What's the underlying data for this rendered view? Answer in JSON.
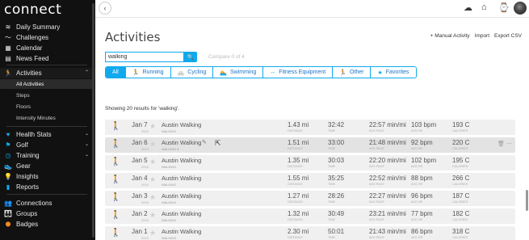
{
  "app": {
    "logo": "connect"
  },
  "sidebar": {
    "items": [
      {
        "label": "Daily Summary",
        "icon": "≋",
        "icon_name": "daily-summary-icon"
      },
      {
        "label": "Challenges",
        "icon": "〜",
        "icon_name": "challenges-icon"
      },
      {
        "label": "Calendar",
        "icon": "▦",
        "icon_name": "calendar-icon"
      },
      {
        "label": "News Feed",
        "icon": "▤",
        "icon_name": "news-feed-icon"
      }
    ],
    "activities": {
      "label": "Activities",
      "icon": "🏃",
      "chevron": "⌃",
      "subitems": [
        {
          "label": "All Activities",
          "active": true
        },
        {
          "label": "Steps"
        },
        {
          "label": "Floors"
        },
        {
          "label": "Intensity Minutes"
        }
      ]
    },
    "lower_items": [
      {
        "label": "Health Stats",
        "icon": "♥",
        "chevron": "⌄",
        "icon_name": "health-stats-icon"
      },
      {
        "label": "Golf",
        "icon": "⚑",
        "chevron": "⌄",
        "icon_name": "golf-icon"
      },
      {
        "label": "Training",
        "icon": "◷",
        "chevron": "⌄",
        "icon_name": "training-icon"
      },
      {
        "label": "Gear",
        "icon": "👟",
        "icon_name": "gear-shoe-icon"
      },
      {
        "label": "Insights",
        "icon": "💡",
        "icon_name": "insights-icon"
      },
      {
        "label": "Reports",
        "icon": "▮",
        "icon_name": "reports-icon"
      }
    ],
    "social_items": [
      {
        "label": "Connections",
        "icon": "👥",
        "icon_name": "connections-icon"
      },
      {
        "label": "Groups",
        "icon": "👪",
        "icon_name": "groups-icon"
      },
      {
        "label": "Badges",
        "icon": "⬢",
        "icon_name": "badges-icon"
      }
    ]
  },
  "topbar": {
    "back": "‹",
    "icons": [
      {
        "name": "upload-icon",
        "glyph": "☁"
      },
      {
        "name": "device-icon",
        "glyph": "⌂"
      },
      {
        "name": "watch-icon",
        "glyph": "⌚"
      }
    ]
  },
  "main": {
    "title": "Activities",
    "links": [
      "+ Manual Activity",
      "Import",
      "Export CSV"
    ],
    "search": {
      "value": "walking",
      "placeholder": "Search",
      "button": "🔍"
    },
    "compare": "Compare 0 of 4",
    "tabs": [
      {
        "label": "All",
        "icon": "",
        "active": true
      },
      {
        "label": "Running",
        "icon": "🏃"
      },
      {
        "label": "Cycling",
        "icon": "🚲"
      },
      {
        "label": "Swimming",
        "icon": "🏊"
      },
      {
        "label": "Fitness Equipment",
        "icon": "↔"
      },
      {
        "label": "Other",
        "icon": "🏃"
      },
      {
        "label": "Favorites",
        "icon": "★"
      }
    ],
    "results": "Showing 20 results for 'walking'.",
    "stat_labels": [
      "Distance",
      "Time",
      "Avg Pace",
      "Avg HR",
      "Calories"
    ],
    "activities": [
      {
        "date": "Jan 7",
        "year": "2019",
        "name": "Austin Walking",
        "type": "Walking",
        "distance": "1.43 mi",
        "time": "32:42",
        "pace": "22:57 min/mi",
        "hr": "103 bpm",
        "calories": "193 C"
      },
      {
        "date": "Jan 6",
        "year": "2019",
        "name": "Austin Walking",
        "type": "Walking ▾",
        "distance": "1.51 mi",
        "time": "33:00",
        "pace": "21:48 min/mi",
        "hr": "92 bpm",
        "calories": "220 C",
        "hover": true
      },
      {
        "date": "Jan 5",
        "year": "2019",
        "name": "Austin Walking",
        "type": "Walking",
        "distance": "1.35 mi",
        "time": "30:03",
        "pace": "22:20 min/mi",
        "hr": "102 bpm",
        "calories": "195 C"
      },
      {
        "date": "Jan 4",
        "year": "2019",
        "name": "Austin Walking",
        "type": "Walking",
        "distance": "1.55 mi",
        "time": "35:25",
        "pace": "22:52 min/mi",
        "hr": "88 bpm",
        "calories": "266 C"
      },
      {
        "date": "Jan 3",
        "year": "2019",
        "name": "Austin Walking",
        "type": "Walking",
        "distance": "1.27 mi",
        "time": "28:26",
        "pace": "22:27 min/mi",
        "hr": "96 bpm",
        "calories": "187 C"
      },
      {
        "date": "Jan 2",
        "year": "2019",
        "name": "Austin Walking",
        "type": "Walking",
        "distance": "1.32 mi",
        "time": "30:49",
        "pace": "23:21 min/mi",
        "hr": "77 bpm",
        "calories": "182 C"
      },
      {
        "date": "Jan 1",
        "year": "2019",
        "name": "Austin Walking",
        "type": "Walking",
        "distance": "2.30 mi",
        "time": "50:01",
        "pace": "21:43 min/mi",
        "hr": "86 bpm",
        "calories": "318 C"
      }
    ]
  },
  "colors": {
    "accent": "#11a9ed",
    "sidebar_bg": "#111111",
    "row_bg": "#f0f0f0"
  }
}
